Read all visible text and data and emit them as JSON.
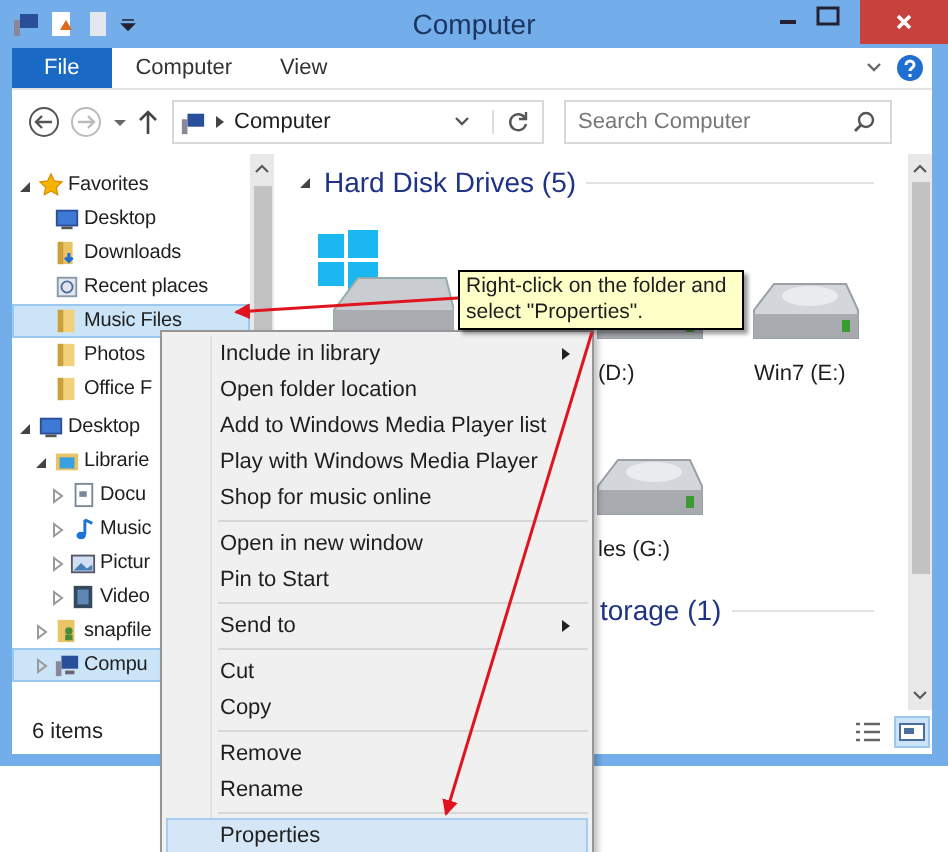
{
  "window": {
    "title": "Computer"
  },
  "ribbon": {
    "tabs": [
      {
        "label": "File",
        "selected": true
      },
      {
        "label": "Computer",
        "selected": false
      },
      {
        "label": "View",
        "selected": false
      }
    ]
  },
  "address": {
    "path": "Computer"
  },
  "search": {
    "placeholder": "Search Computer"
  },
  "nav": {
    "items": [
      {
        "label": "Favorites",
        "kind": "star",
        "expanded": true,
        "selected": false,
        "children": [
          {
            "label": "Desktop",
            "kind": "monitor",
            "selected": false
          },
          {
            "label": "Downloads",
            "kind": "download",
            "selected": false
          },
          {
            "label": "Recent places",
            "kind": "recent",
            "selected": false
          },
          {
            "label": "Music Files",
            "kind": "folder",
            "selected": true
          },
          {
            "label": "Photos",
            "kind": "folder",
            "selected": false
          },
          {
            "label": "Office F",
            "kind": "folder",
            "selected": false
          }
        ]
      },
      {
        "label": "Desktop",
        "kind": "monitor",
        "expanded": true,
        "selected": false,
        "children": [
          {
            "label": "Librarie",
            "kind": "library",
            "expanded": true,
            "selected": false,
            "children": [
              {
                "label": "Docu",
                "kind": "document",
                "expanded": false,
                "selected": false
              },
              {
                "label": "Music",
                "kind": "music",
                "expanded": false,
                "selected": false
              },
              {
                "label": "Pictur",
                "kind": "picture",
                "expanded": false,
                "selected": false
              },
              {
                "label": "Video",
                "kind": "video",
                "expanded": false,
                "selected": false
              }
            ]
          },
          {
            "label": "snapfile",
            "kind": "user",
            "expanded": false,
            "selected": false
          },
          {
            "label": "Compu",
            "kind": "computer",
            "expanded": false,
            "selected": true
          }
        ]
      }
    ]
  },
  "content": {
    "sections": [
      {
        "heading": "Hard Disk Drives (5)",
        "expanded": true
      },
      {
        "heading": "torage (1)"
      }
    ],
    "drives": [
      {
        "kind": "system"
      },
      {
        "kind": "disk",
        "label": "(D:)"
      },
      {
        "kind": "disk",
        "label": "Win7 (E:)"
      },
      {
        "kind": "disk",
        "label": "les (G:)"
      }
    ]
  },
  "status_bar": {
    "text": "6 items"
  },
  "context_menu": {
    "groups": [
      [
        {
          "label": "Include in library",
          "submenu": true,
          "selected": false
        },
        {
          "label": "Open folder location",
          "submenu": false,
          "selected": false
        },
        {
          "label": "Add to Windows Media Player list",
          "submenu": false,
          "selected": false
        },
        {
          "label": "Play with Windows Media Player",
          "submenu": false,
          "selected": false
        },
        {
          "label": "Shop for music online",
          "submenu": false,
          "selected": false
        }
      ],
      [
        {
          "label": "Open in new window",
          "submenu": false,
          "selected": false
        },
        {
          "label": "Pin to Start",
          "submenu": false,
          "selected": false
        }
      ],
      [
        {
          "label": "Send to",
          "submenu": true,
          "selected": false
        }
      ],
      [
        {
          "label": "Cut",
          "submenu": false,
          "selected": false
        },
        {
          "label": "Copy",
          "submenu": false,
          "selected": false
        }
      ],
      [
        {
          "label": "Remove",
          "submenu": false,
          "selected": false
        },
        {
          "label": "Rename",
          "submenu": false,
          "selected": false
        }
      ],
      [
        {
          "label": "Properties",
          "submenu": false,
          "selected": true
        }
      ]
    ]
  },
  "callout": {
    "text": "Right-click on the folder and select \"Properties\"."
  }
}
